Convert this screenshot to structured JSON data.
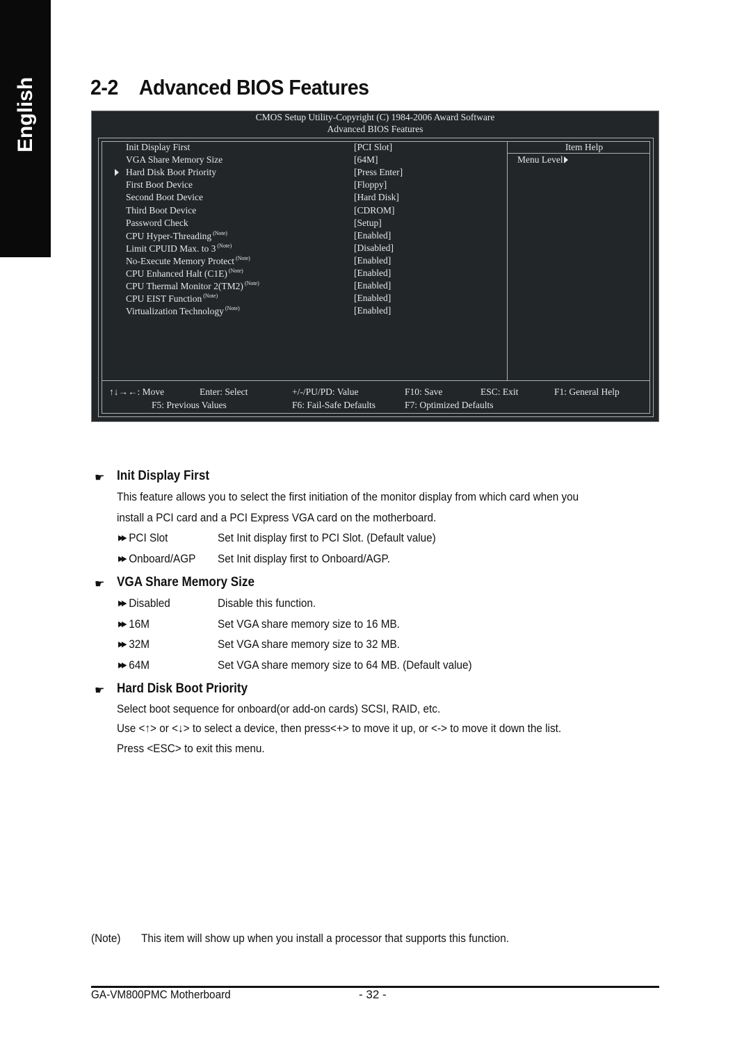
{
  "sidebar_tab": {
    "label": "English"
  },
  "section": {
    "number": "2-2",
    "title": "Advanced BIOS Features"
  },
  "bios": {
    "header_line1": "CMOS Setup Utility-Copyright (C) 1984-2006 Award Software",
    "header_line2": "Advanced BIOS Features",
    "items": [
      {
        "label": "Init Display First",
        "note": "",
        "value": "[PCI Slot]",
        "submenu": false
      },
      {
        "label": "VGA Share Memory Size",
        "note": "",
        "value": "[64M]",
        "submenu": false
      },
      {
        "label": "Hard Disk Boot Priority",
        "note": "",
        "value": "[Press Enter]",
        "submenu": true
      },
      {
        "label": "First Boot Device",
        "note": "",
        "value": "[Floppy]",
        "submenu": false
      },
      {
        "label": "Second Boot Device",
        "note": "",
        "value": "[Hard Disk]",
        "submenu": false
      },
      {
        "label": "Third Boot Device",
        "note": "",
        "value": "[CDROM]",
        "submenu": false
      },
      {
        "label": "Password Check",
        "note": "",
        "value": "[Setup]",
        "submenu": false
      },
      {
        "label": "CPU Hyper-Threading",
        "note": "(Note)",
        "value": "[Enabled]",
        "submenu": false
      },
      {
        "label": "Limit CPUID Max. to 3",
        "note": "(Note)",
        "value": "[Disabled]",
        "submenu": false
      },
      {
        "label": "No-Execute Memory Protect",
        "note": "(Note)",
        "value": "[Enabled]",
        "submenu": false
      },
      {
        "label": "CPU Enhanced Halt (C1E)",
        "note": "(Note)",
        "value": "[Enabled]",
        "submenu": false
      },
      {
        "label": "CPU Thermal Monitor 2(TM2)",
        "note": "(Note)",
        "value": "[Enabled]",
        "submenu": false
      },
      {
        "label": "CPU EIST Function",
        "note": "(Note)",
        "value": "[Enabled]",
        "submenu": false
      },
      {
        "label": "Virtualization Technology",
        "note": "(Note)",
        "value": "[Enabled]",
        "submenu": false
      }
    ],
    "help": {
      "title": "Item Help",
      "menu_level": "Menu Level"
    },
    "keys_row1": {
      "move": "↑↓→←: Move",
      "select": "Enter: Select",
      "value": "+/-/PU/PD: Value",
      "save": "F10: Save",
      "exit": "ESC: Exit",
      "help": "F1: General Help"
    },
    "keys_row2": {
      "previous": "F5: Previous Values",
      "failsafe": "F6: Fail-Safe Defaults",
      "optimized": "F7: Optimized Defaults"
    }
  },
  "descriptions": {
    "init_display": {
      "heading": "Init Display First",
      "text_line1": "This feature allows you to select the first initiation of the monitor display from which card when you",
      "text_line2": "install a PCI card and a PCI Express VGA card on the motherboard.",
      "options": [
        {
          "name": "PCI Slot",
          "desc": "Set Init display first to PCI Slot. (Default value)"
        },
        {
          "name": "Onboard/AGP",
          "desc": "Set Init display first to Onboard/AGP."
        }
      ]
    },
    "vga_memory": {
      "heading": "VGA Share Memory Size",
      "options": [
        {
          "name": "Disabled",
          "desc": "Disable this function."
        },
        {
          "name": "16M",
          "desc": "Set VGA share memory size to 16 MB."
        },
        {
          "name": "32M",
          "desc": "Set VGA share memory size to 32 MB."
        },
        {
          "name": "64M",
          "desc": "Set VGA share memory size to 64 MB. (Default value)"
        }
      ]
    },
    "hdd_priority": {
      "heading": "Hard Disk Boot Priority",
      "line1": "Select boot sequence for onboard(or add-on cards) SCSI, RAID, etc.",
      "line2": "Use <↑> or <↓> to select a device, then press<+> to move it up, or <-> to move it down the list.",
      "line3": "Press <ESC> to exit this menu."
    }
  },
  "note": {
    "tag": "(Note)",
    "text": "This item will show up when you install a processor that supports this function."
  },
  "footer": {
    "product": "GA-VM800PMC Motherboard",
    "page": "- 32 -"
  }
}
